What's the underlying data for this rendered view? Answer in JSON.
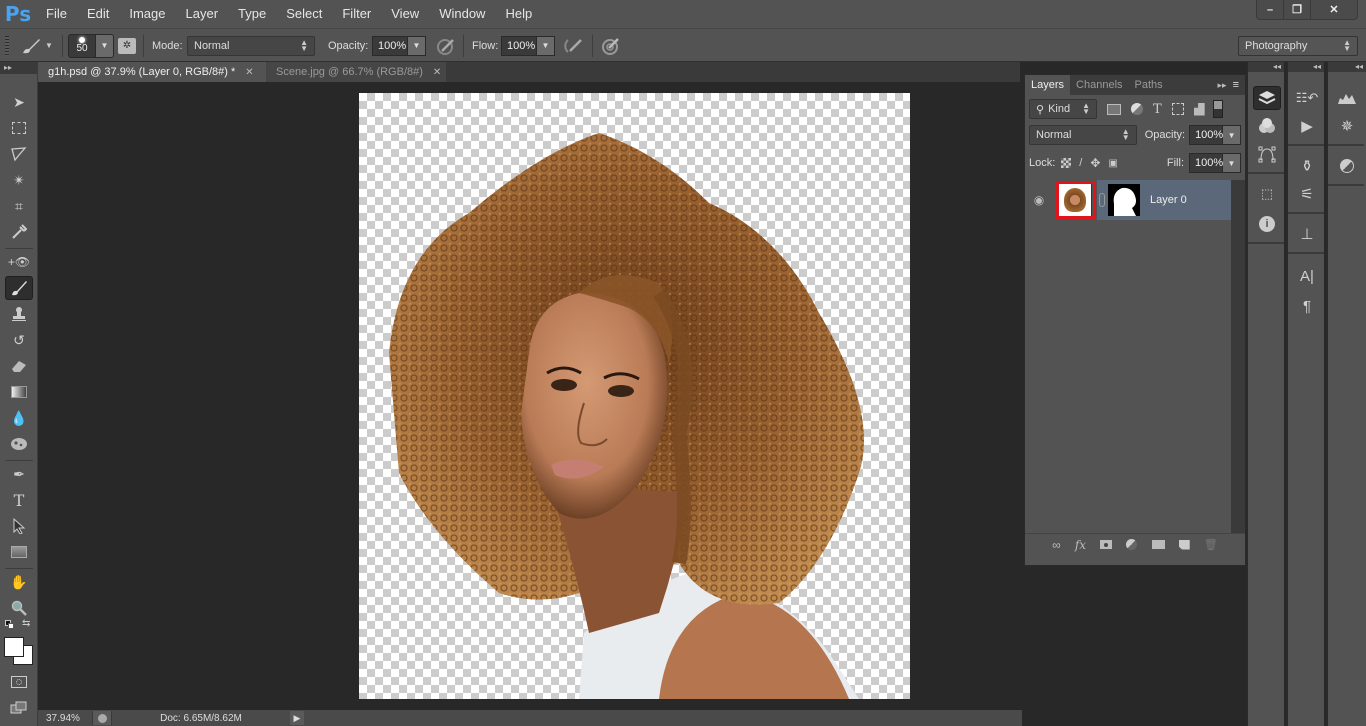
{
  "app": {
    "logo": "Ps"
  },
  "menu": [
    "File",
    "Edit",
    "Image",
    "Layer",
    "Type",
    "Select",
    "Filter",
    "View",
    "Window",
    "Help"
  ],
  "window_controls": {
    "minimize": "–",
    "restore": "❐",
    "close": "✕"
  },
  "options": {
    "brush_size": "50",
    "mode_label": "Mode:",
    "mode_value": "Normal",
    "opacity_label": "Opacity:",
    "opacity_value": "100%",
    "flow_label": "Flow:",
    "flow_value": "100%",
    "workspace": "Photography"
  },
  "tabs": [
    {
      "label": "g1h.psd @ 37.9% (Layer 0, RGB/8#) *",
      "close": "✕",
      "active": true
    },
    {
      "label": "Scene.jpg @ 66.7% (RGB/8#)",
      "close": "✕",
      "active": false
    }
  ],
  "status": {
    "zoom": "37.94%",
    "doc": "Doc: 6.65M/8.62M"
  },
  "layers_panel": {
    "tabs": [
      "Layers",
      "Channels",
      "Paths"
    ],
    "filter_kind": "Kind",
    "blend_mode": "Normal",
    "opacity_label": "Opacity:",
    "opacity_value": "100%",
    "lock_label": "Lock:",
    "fill_label": "Fill:",
    "fill_value": "100%",
    "layers": [
      {
        "name": "Layer 0",
        "visible": true,
        "selected": true
      }
    ],
    "highlight_color": "#e0141b"
  },
  "icons": {
    "eye": "👁",
    "lock": "🔒",
    "move": "✥",
    "brush": "🖌",
    "type": "T",
    "search": "⚲",
    "link": "∞",
    "fx": "fx",
    "folder": "▬",
    "trash": "🗑",
    "info": "ℹ",
    "paragraph": "¶",
    "play": "▶"
  }
}
